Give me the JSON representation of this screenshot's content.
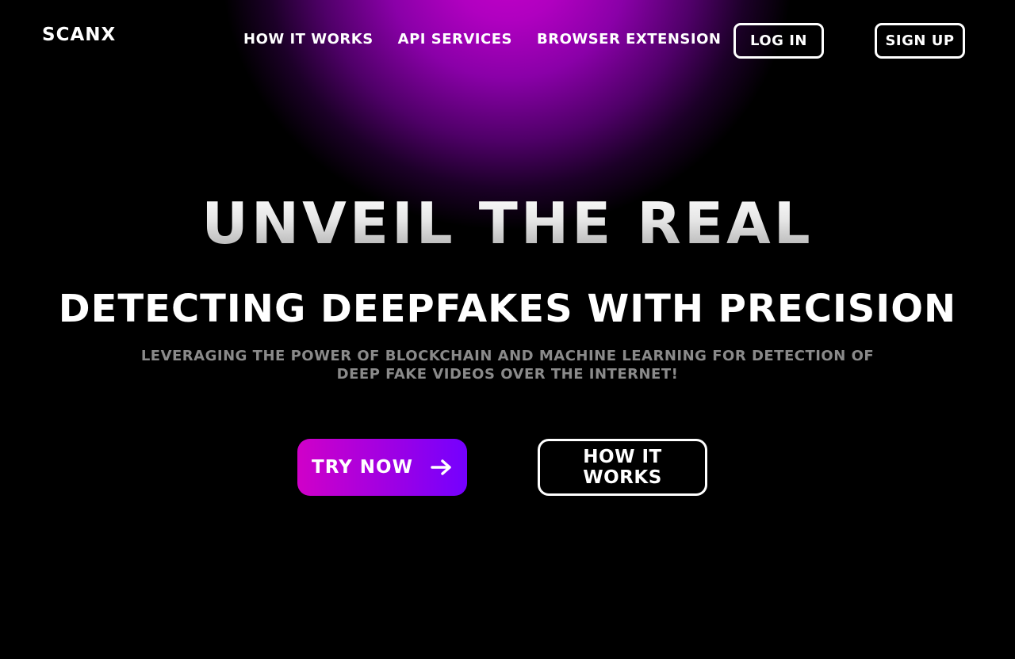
{
  "brand": {
    "logo": "SCANX"
  },
  "nav": {
    "items": [
      {
        "label": "HOW IT WORKS"
      },
      {
        "label": "API SERVICES"
      },
      {
        "label": "BROWSER EXTENSION"
      }
    ]
  },
  "auth": {
    "login_label": "LOG IN",
    "signup_label": "SIGN UP"
  },
  "hero": {
    "title": "UNVEIL THE REAL",
    "subtitle": "DETECTING DEEPFAKES WITH PRECISION",
    "description": "LEVERAGING THE POWER OF BLOCKCHAIN AND MACHINE LEARNING FOR DETECTION OF DEEP FAKE VIDEOS OVER THE INTERNET!"
  },
  "cta": {
    "try_label": "TRY NOW",
    "try_icon": "arrow-right-icon",
    "how_label": "HOW IT WORKS"
  },
  "colors": {
    "background": "#000000",
    "glow": "#c400c9",
    "button_gradient_start": "#d000c8",
    "button_gradient_end": "#7400ff"
  }
}
